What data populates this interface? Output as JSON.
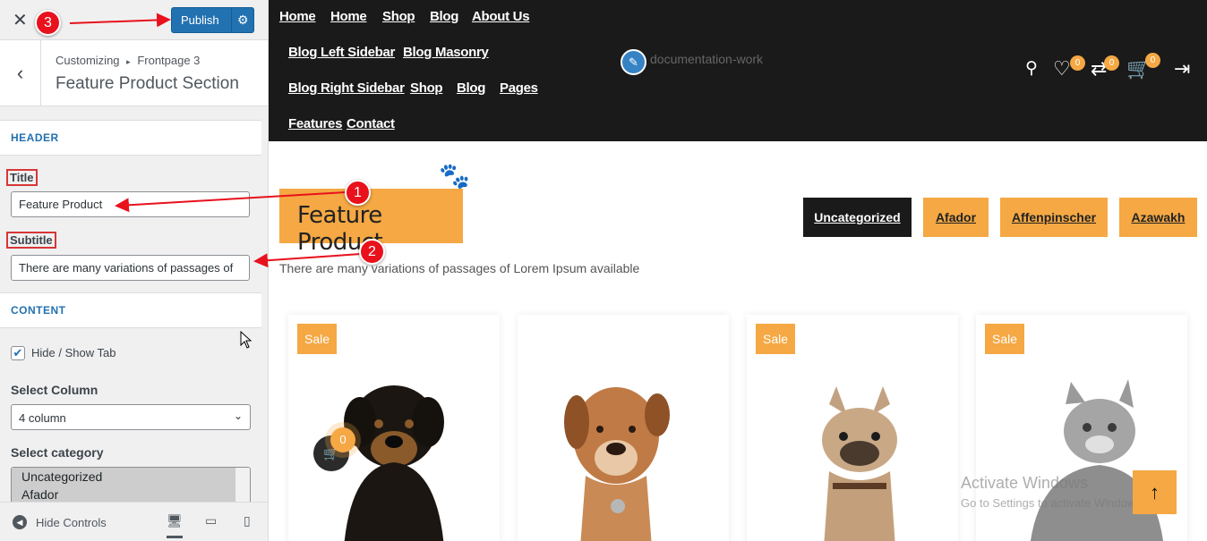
{
  "customizer": {
    "close_icon": "close-icon",
    "publish_label": "Publish",
    "breadcrumb_root": "Customizing",
    "breadcrumb_sep": "▸",
    "breadcrumb_page": "Frontpage 3",
    "section_title": "Feature Product Section",
    "header_section": "HEADER",
    "title_label": "Title",
    "title_value": "Feature Product",
    "subtitle_label": "Subtitle",
    "subtitle_value": "There are many variations of passages of",
    "content_section": "CONTENT",
    "hide_show_tab_label": "Hide / Show Tab",
    "hide_show_tab_checked": true,
    "select_column_label": "Select Column",
    "select_column_value": "4 column",
    "select_category_label": "Select category",
    "categories": [
      "Uncategorized",
      "Afador"
    ],
    "hide_controls_label": "Hide Controls"
  },
  "site": {
    "nav_row1": [
      "Home",
      "Home",
      "Shop",
      "Blog",
      "About Us"
    ],
    "nav_row2": [
      "Blog Left Sidebar",
      "Blog Masonry"
    ],
    "nav_row3": [
      "Blog Right Sidebar",
      "Shop",
      "Blog",
      "Pages"
    ],
    "nav_row4": [
      "Features",
      "Contact"
    ],
    "logo_alt": "documentation-work",
    "wishlist_count": "0",
    "compare_count": "0",
    "cart_count": "0",
    "section_title": "Feature Product",
    "section_subtitle": "There are many variations of passages of Lorem Ipsum available",
    "tabs": [
      "Uncategorized",
      "Afador",
      "Affenpinscher",
      "Azawakh"
    ],
    "sale_label": "Sale",
    "fab_cart_count": "0",
    "watermark_title": "Activate Windows",
    "watermark_sub": "Go to Settings to activate Windows."
  },
  "annotations": [
    "1",
    "2",
    "3"
  ],
  "colors": {
    "accent": "#f5a843",
    "header_bg": "#1a1a1a",
    "wp_blue": "#2271b1",
    "annotation_red": "#e8111c"
  }
}
